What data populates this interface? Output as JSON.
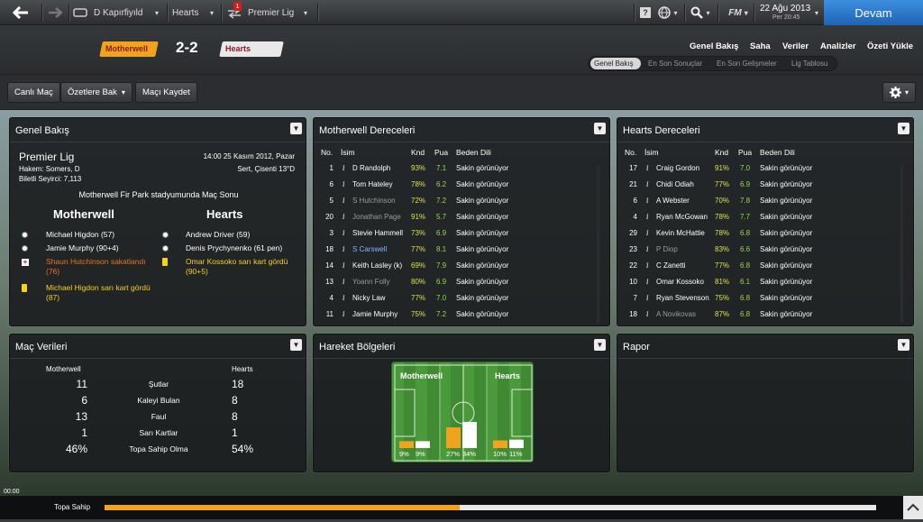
{
  "topbar": {
    "team1": "D Kapırfiyıld",
    "team2": "Hearts",
    "notif_count": "1",
    "competition": "Premier Lig",
    "fm_logo": "FM",
    "date": "22 Ağu 2013",
    "day_time": "Per 20:45",
    "devam": "Devam"
  },
  "header": {
    "home_team": "Motherwell",
    "score": "2-2",
    "away_team": "Hearts",
    "nav": [
      "Genel Bakış",
      "Saha",
      "Veriler",
      "Analizler",
      "Özeti Yükle"
    ],
    "tabs": [
      "Genel Bakış",
      "En Son Sonuçlar",
      "En Son Gelişmeler",
      "Lig Tablosu"
    ]
  },
  "toolbar": {
    "live": "Canlı Maç",
    "highlights": "Özetlere Bak",
    "save": "Maçı Kaydet"
  },
  "overview": {
    "title": "Genel Bakış",
    "competition": "Premier Lig",
    "datetime": "14:00 25 Kasım 2012, Pazar",
    "referee": "Hakem: Somers, D",
    "weather": "Sert, Çisenti 13°D",
    "attendance": "Biletli Seyirci: 7,113",
    "result_line": "Motherwell Fir Park stadyumunda Maç Sonu",
    "home": "Motherwell",
    "away": "Hearts",
    "home_events": [
      {
        "text": "Michael Higdon (57)",
        "icon": "goal",
        "color": "#ffffff"
      },
      {
        "text": "Jamie Murphy (90+4)",
        "icon": "goal",
        "color": "#ffffff"
      },
      {
        "text": "Shaun Hutchinson sakatlandı",
        "text2": "(76)",
        "icon": "injury",
        "color": "#e8741c"
      },
      {
        "text": "Michael Higdon sarı kart gördü",
        "text2": "(87)",
        "icon": "yellow",
        "color": "#f3d21a"
      }
    ],
    "away_events": [
      {
        "text": "Andrew Driver (59)",
        "icon": "goal",
        "color": "#ffffff"
      },
      {
        "text": "Denis Prychynenko (61 pen)",
        "icon": "goal",
        "color": "#ffffff"
      },
      {
        "text": "Omar Kossoko sarı kart gördü",
        "text2": "(90+5)",
        "icon": "yellow",
        "color": "#f3d21a"
      }
    ]
  },
  "motherwell_ratings": {
    "title": "Motherwell Dereceleri",
    "headers": [
      "No.",
      "İsim",
      "Knd",
      "Pua",
      "Beden Dili"
    ],
    "rows": [
      [
        "1",
        "D Randolph",
        "93%",
        "7.1",
        "Sakin görünüyor",
        "#ffffff"
      ],
      [
        "6",
        "Tom Hateley",
        "78%",
        "6.2",
        "Sakin görünüyor",
        "#ffffff"
      ],
      [
        "5",
        "S Hutchinson",
        "72%",
        "7.2",
        "Sakin görünüyor",
        "#9a9a9a"
      ],
      [
        "20",
        "Jonathan Page",
        "91%",
        "5.7",
        "Sakin görünüyor",
        "#9a9a9a"
      ],
      [
        "3",
        "Stevie Hammell",
        "73%",
        "6.9",
        "Sakin görünüyor",
        "#ffffff"
      ],
      [
        "18",
        "S Carswell",
        "77%",
        "8.1",
        "Sakin görünüyor",
        "#7fb8ff"
      ],
      [
        "14",
        "Keith Lasley (k)",
        "69%",
        "7.9",
        "Sakin görünüyor",
        "#ffffff"
      ],
      [
        "13",
        "Yoann Folly",
        "80%",
        "6.9",
        "Sakin görünüyor",
        "#9a9a9a"
      ],
      [
        "4",
        "Nicky Law",
        "77%",
        "7.0",
        "Sakin görünüyor",
        "#ffffff"
      ],
      [
        "11",
        "Jamie Murphy",
        "75%",
        "7.2",
        "Sakin görünüyor",
        "#ffffff"
      ]
    ]
  },
  "hearts_ratings": {
    "title": "Hearts Dereceleri",
    "headers": [
      "No.",
      "İsim",
      "Knd",
      "Pua",
      "Beden Dili"
    ],
    "rows": [
      [
        "17",
        "Craig Gordon",
        "91%",
        "7.0",
        "Sakin görünüyor",
        "#ffffff"
      ],
      [
        "21",
        "Chidi Odiah",
        "77%",
        "6.9",
        "Sakin görünüyor",
        "#ffffff"
      ],
      [
        "6",
        "A Webster",
        "70%",
        "7.8",
        "Sakin görünüyor",
        "#ffffff"
      ],
      [
        "4",
        "Ryan McGowan",
        "78%",
        "7.7",
        "Sakin görünüyor",
        "#ffffff"
      ],
      [
        "29",
        "Kevin McHattie",
        "78%",
        "6.8",
        "Sakin görünüyor",
        "#ffffff"
      ],
      [
        "23",
        "P Diop",
        "83%",
        "6.6",
        "Sakin görünüyor",
        "#9a9a9a"
      ],
      [
        "22",
        "C Zanetti",
        "77%",
        "6.8",
        "Sakin görünüyor",
        "#ffffff"
      ],
      [
        "10",
        "Omar Kossoko",
        "81%",
        "6.1",
        "Sakin görünüyor",
        "#ffffff"
      ],
      [
        "7",
        "Ryan Stevenson",
        "75%",
        "6.8",
        "Sakin görünüyor",
        "#ffffff"
      ],
      [
        "18",
        "A Novikovas",
        "87%",
        "6.8",
        "Sakin görünüyor",
        "#9a9a9a"
      ]
    ]
  },
  "match_stats": {
    "title": "Maç Verileri",
    "home": "Motherwell",
    "away": "Hearts",
    "rows": [
      [
        "11",
        "Şutlar",
        "18"
      ],
      [
        "6",
        "Kaleyi Bulan",
        "8"
      ],
      [
        "13",
        "Faul",
        "8"
      ],
      [
        "1",
        "Sarı Kartlar",
        "1"
      ],
      [
        "46%",
        "Topa Sahip Olma",
        "54%"
      ]
    ]
  },
  "zones": {
    "title": "Hareket Bölgeleri",
    "home": "Motherwell",
    "away": "Hearts",
    "values": [
      {
        "h": 9,
        "a": 9,
        "hl": "9%",
        "al": "9%"
      },
      {
        "h": 27,
        "a": 34,
        "hl": "27%",
        "al": "34%"
      },
      {
        "h": 10,
        "a": 11,
        "hl": "10%",
        "al": "11%"
      }
    ]
  },
  "report": {
    "title": "Rapor"
  },
  "status": {
    "clock": "00:00",
    "possession_label": "Topa Sahip",
    "possession_home_pct": 46
  }
}
